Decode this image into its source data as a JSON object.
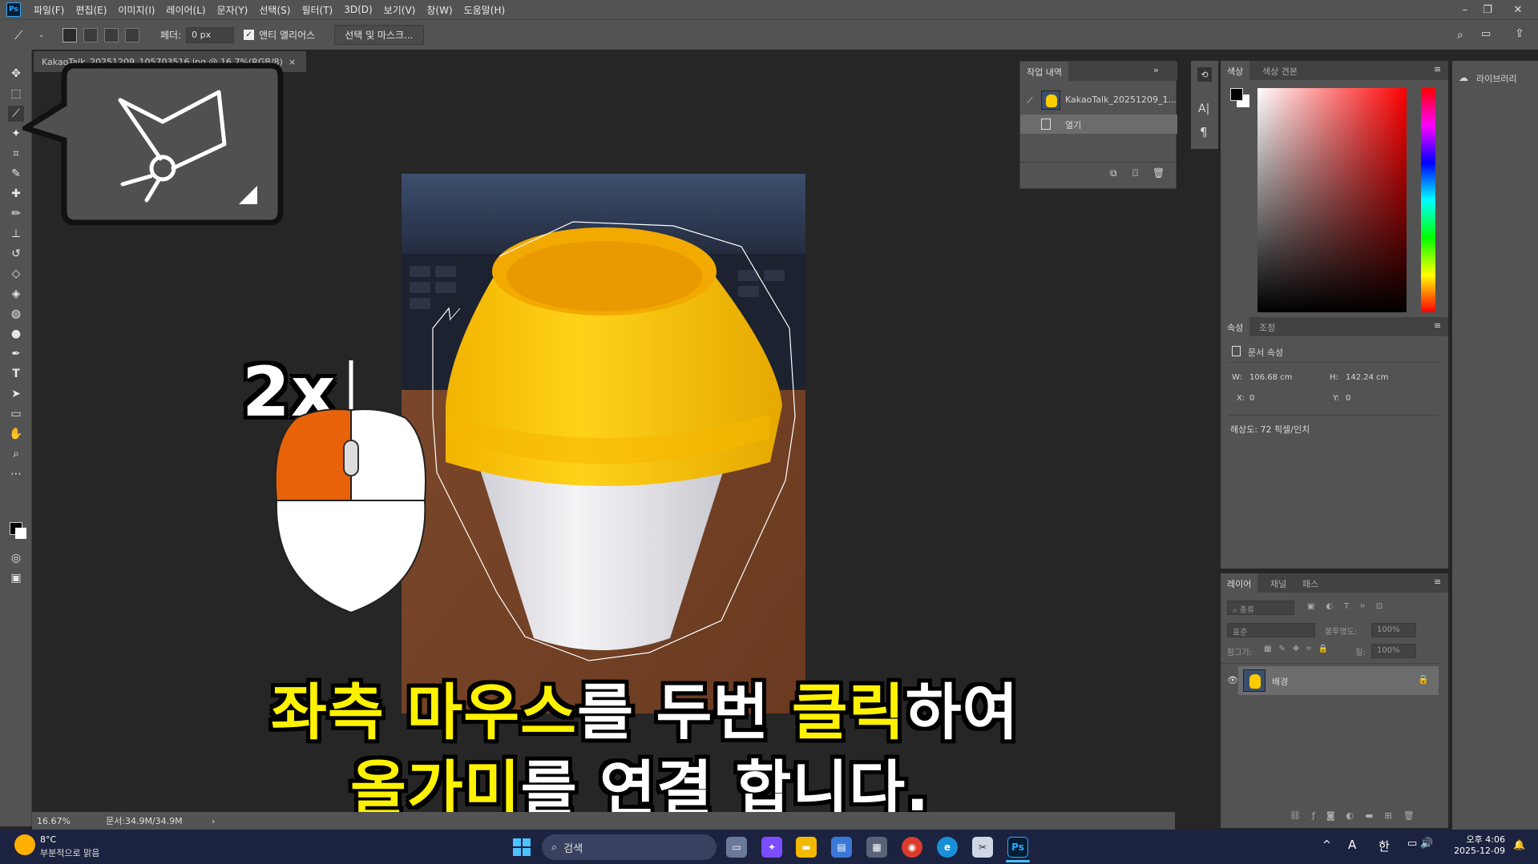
{
  "menubar": {
    "logo": "Ps",
    "items": [
      "파일(F)",
      "편집(E)",
      "이미지(I)",
      "레이어(L)",
      "문자(Y)",
      "선택(S)",
      "필터(T)",
      "3D(D)",
      "보기(V)",
      "창(W)",
      "도움말(H)"
    ]
  },
  "optionsbar": {
    "feather_label": "페더:",
    "feather_value": "0 px",
    "antialias_label": "앤티 앨리어스",
    "select_mask_button": "선택 및 마스크..."
  },
  "document_tab": {
    "title": "KakaoTalk_20251209_105703516.jpg @ 16.7%(RGB/8) *",
    "close": "×"
  },
  "history_panel": {
    "tab": "작업 내역",
    "snapshot_name": "KakaoTalk_20251209_1...",
    "step_open": "열기"
  },
  "color_panel": {
    "tabs": [
      "색상",
      "색상 견본"
    ],
    "foreground": "#000000",
    "background": "#ffffff"
  },
  "libraries": {
    "label": "라이브러리"
  },
  "properties_panel": {
    "tabs": [
      "속성",
      "조정"
    ],
    "section": "문서 속성",
    "w_label": "W:",
    "w_value": "106.68 cm",
    "h_label": "H:",
    "h_value": "142.24 cm",
    "x_label": "X:",
    "x_value": "0",
    "y_label": "Y:",
    "y_value": "0",
    "resolution": "해상도: 72 픽셀/인치"
  },
  "layers_panel": {
    "tabs": [
      "레이어",
      "채널",
      "패스"
    ],
    "filter_placeholder": "종류",
    "blend_mode": "표준",
    "opacity_label": "불투명도:",
    "opacity_value": "100%",
    "lock_label": "잠그기:",
    "fill_label": "칠:",
    "fill_value": "100%",
    "layer_name": "배경"
  },
  "statusbar": {
    "zoom": "16.67%",
    "doc_size": "문서:34.9M/34.9M",
    "arrow": "›"
  },
  "overlay": {
    "click_count": "2x",
    "subtitle_line1": [
      {
        "text": "좌측 ",
        "color": "yellow"
      },
      {
        "text": "마우스",
        "color": "yellow"
      },
      {
        "text": "를 두번 ",
        "color": "white"
      },
      {
        "text": "클릭",
        "color": "yellow"
      },
      {
        "text": "하여",
        "color": "white"
      }
    ],
    "subtitle_line2": [
      {
        "text": "올가미",
        "color": "yellow"
      },
      {
        "text": "를 연결 합니다.",
        "color": "white"
      }
    ]
  },
  "taskbar": {
    "weather_temp": "8°C",
    "weather_desc": "부분적으로 맑음",
    "search_placeholder": "검색",
    "ime_a": "A",
    "ime_han": "한",
    "time": "오후 4:06",
    "date": "2025-12-09"
  },
  "colors": {
    "ui_panel": "#535353",
    "canvas_bg": "#262626",
    "subtitle_yellow": "#fff200",
    "mouse_orange": "#e8620a"
  }
}
